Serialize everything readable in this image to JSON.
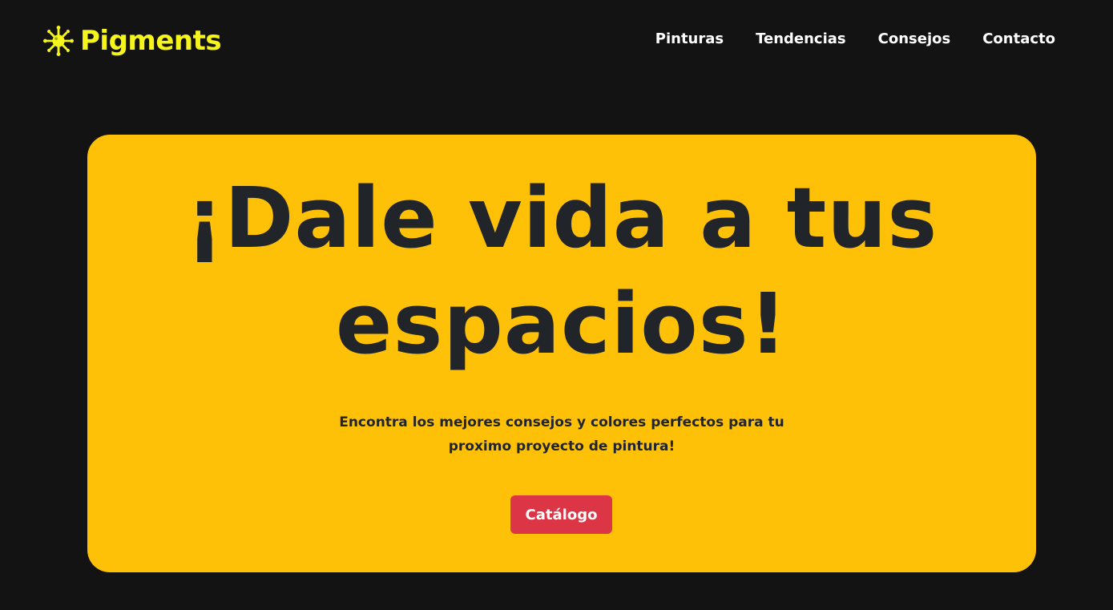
{
  "navbar": {
    "brand": {
      "icon": "paint-splash-icon",
      "name": "Pigments",
      "color": "#f5f51b"
    },
    "links": [
      {
        "label": "Pinturas"
      },
      {
        "label": "Tendencias"
      },
      {
        "label": "Consejos"
      },
      {
        "label": "Contacto"
      }
    ]
  },
  "hero": {
    "title_line1": "¡Dale vida a tus",
    "title_line2": "espacios!",
    "subtitle": "Encontra los mejores consejos y colores perfectos para tu proximo proyecto de pintura!",
    "button_label": "Catálogo",
    "background_color": "#ffc107",
    "button_color": "#dc3545"
  },
  "page": {
    "background_color": "#131313"
  }
}
